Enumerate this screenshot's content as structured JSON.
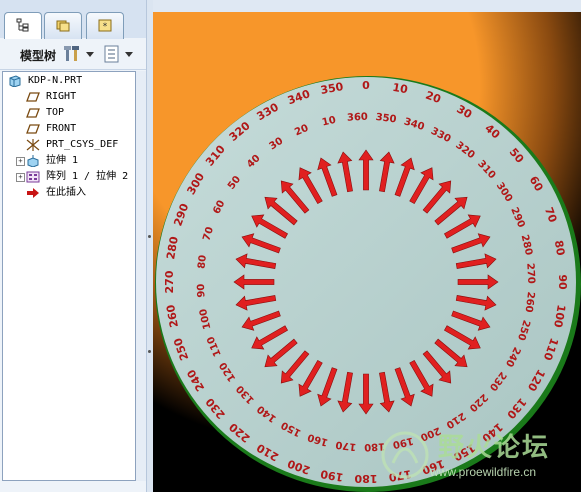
{
  "tabs": [
    {
      "name": "model-tree-tab",
      "active": true
    },
    {
      "name": "folder-browser-tab",
      "active": false
    },
    {
      "name": "favorites-tab",
      "active": false
    }
  ],
  "toolbar": {
    "title": "模型树"
  },
  "tree": {
    "items": [
      {
        "label": "KDP-N.PRT",
        "icon": "part-icon",
        "expander": ""
      },
      {
        "label": "RIGHT",
        "icon": "datum-plane-icon",
        "expander": ""
      },
      {
        "label": "TOP",
        "icon": "datum-plane-icon",
        "expander": ""
      },
      {
        "label": "FRONT",
        "icon": "datum-plane-icon",
        "expander": ""
      },
      {
        "label": "PRT_CSYS_DEF",
        "icon": "csys-icon",
        "expander": ""
      },
      {
        "label": "拉伸 1",
        "icon": "extrude-icon",
        "expander": "+"
      },
      {
        "label": "阵列 1 / 拉伸 2",
        "icon": "pattern-icon",
        "expander": "+"
      },
      {
        "label": "在此插入",
        "icon": "insert-here-arrow-icon",
        "expander": ""
      }
    ]
  },
  "dial": {
    "outer_labels": [
      "0",
      "10",
      "20",
      "30",
      "40",
      "50",
      "60",
      "70",
      "80",
      "90",
      "100",
      "110",
      "120",
      "130",
      "140",
      "150",
      "160",
      "170",
      "180",
      "190",
      "200",
      "210",
      "220",
      "230",
      "240",
      "250",
      "260",
      "270",
      "280",
      "290",
      "300",
      "310",
      "320",
      "330",
      "340",
      "350"
    ],
    "inner_labels": [
      "360",
      "350",
      "340",
      "330",
      "320",
      "310",
      "300",
      "290",
      "280",
      "270",
      "260",
      "250",
      "240",
      "230",
      "220",
      "210",
      "200",
      "190",
      "180",
      "170",
      "160",
      "150",
      "140",
      "130",
      "120",
      "110",
      "100",
      "90",
      "80",
      "70",
      "60",
      "50",
      "40",
      "30",
      "20",
      "10"
    ],
    "arrow_count": 36,
    "colors": {
      "face": "#b5cfcd",
      "rim": "#2e9a2e",
      "numbers": "#b01818",
      "arrow": "#e02020",
      "glow": "#f7962a"
    }
  },
  "watermark": {
    "text": "野火论坛",
    "url": "www.proewildfire.cn"
  }
}
